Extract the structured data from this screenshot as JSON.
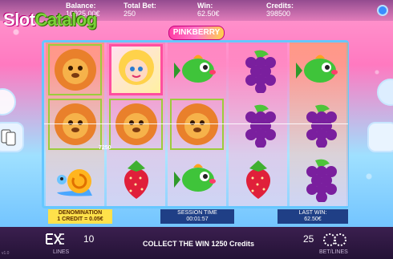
{
  "header": {
    "balance_label": "Balance:",
    "balance_value": "10925.00€",
    "total_bet_label": "Total Bet:",
    "total_bet_value": "250",
    "win_label": "Win:",
    "win_value": "62.50€",
    "credits_label": "Credits:",
    "credits_value": "398500"
  },
  "watermark": {
    "part1": "Slot",
    "part2": "Catalog"
  },
  "game_logo": "PINKBERRY",
  "reels": [
    [
      "lion",
      "lion",
      "snail"
    ],
    [
      "wild-doll",
      "lion",
      "strawberry"
    ],
    [
      "fish",
      "lion",
      "fish"
    ],
    [
      "grapes",
      "grapes",
      "strawberry"
    ],
    [
      "fish",
      "grapes",
      "grapes"
    ]
  ],
  "win_small_value": "7250",
  "panels": {
    "denomination_label": "DENOMINATION",
    "denomination_value": "1 CREDIT = 0.05€",
    "session_label": "SESSION TIME",
    "session_value": "00:01:57",
    "last_win_label": "LAST WIN:",
    "last_win_value": "62.50€"
  },
  "footer": {
    "lines_value": "10",
    "lines_label": "LINES",
    "collect_text": "COLLECT THE WIN 1250 Credits",
    "bet_value": "25",
    "bet_label": "BET/LINES",
    "version": "v1.0"
  },
  "colors": {
    "reel_border": "#66c7ff",
    "panel_dark": "#1f3f86",
    "panel_denom": "#ffe14a",
    "win_cell": "#9ccc3c"
  }
}
